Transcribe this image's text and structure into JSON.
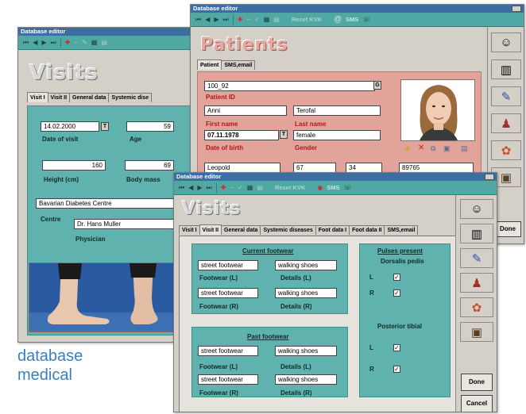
{
  "toolbar": {
    "reset_label": "Reset KVK",
    "at_label": "@",
    "sms_label": "SMS"
  },
  "caption": {
    "line1": "database",
    "line2": "medical"
  },
  "win_visits_back": {
    "title": "Database editor",
    "heading": "Visits",
    "tabs": [
      "Visit I",
      "Visit II",
      "General data",
      "Systemic dise"
    ],
    "date_of_visit": "14.02.2000",
    "date_of_visit_label": "Date of visit",
    "age": "59",
    "age_label": "Age",
    "height": "160",
    "height_label": "Height  (cm)",
    "body_mass": "69",
    "body_mass_label": "Body mass",
    "centre": "Bavarian Diabetes Centre",
    "centre_label": "Centre",
    "physician": "Dr. Hans Muller",
    "physician_label": "Physician",
    "t_button": "T"
  },
  "win_patients": {
    "title": "Database editor",
    "heading": "Patients",
    "tabs": [
      "Patient",
      "SMS,email"
    ],
    "patient_id": "100_92",
    "patient_id_label": "Patient ID",
    "g_button": "G",
    "first_name": "Anni",
    "first_name_label": "First name",
    "last_name": "Terofal",
    "last_name_label": "Last name",
    "dob": "07.11.1978",
    "dob_label": "Date of birth",
    "gender": "female",
    "gender_label": "Gender",
    "t_button": "T",
    "row2": [
      "Leopold",
      "67",
      "34",
      "89765"
    ],
    "done_label": "Done"
  },
  "win_visits_front": {
    "title": "Database editor",
    "heading": "Visits",
    "tabs": [
      "Visit I",
      "Visit II",
      "General data",
      "Systemic diseases",
      "Foot data I",
      "Foot data II",
      "SMS,email"
    ],
    "current_footwear": {
      "heading": "Current footwear",
      "left_footwear": "street footwear",
      "left_details": "walking shoes",
      "left_footwear_label": "Footwear (L)",
      "left_details_label": "Details (L)",
      "right_footwear": "street footwear",
      "right_details": "walking shoes",
      "right_footwear_label": "Footwear (R)",
      "right_details_label": "Details (R)"
    },
    "past_footwear": {
      "heading": "Past footwear",
      "left_footwear": "street footwear",
      "left_details": "walking shoes",
      "left_footwear_label": "Footwear (L)",
      "left_details_label": "Details (L)",
      "right_footwear": "street footwear",
      "right_details": "walking shoes",
      "right_footwear_label": "Footwear (R)",
      "right_details_label": "Details (R)"
    },
    "pulses": {
      "heading": "Pulses present",
      "dorsalis": "Dorsalis pedis",
      "posterior": "Posterior tibial",
      "L": "L",
      "R": "R",
      "check": "✓"
    },
    "done_label": "Done",
    "cancel_label": "Cancel"
  },
  "colors": {
    "teal": "#5fb2ae",
    "toolbar": "#4fa8a4",
    "pink": "#e2a49a",
    "red_label": "#b0171c",
    "caption_blue": "#3a7fc0"
  }
}
